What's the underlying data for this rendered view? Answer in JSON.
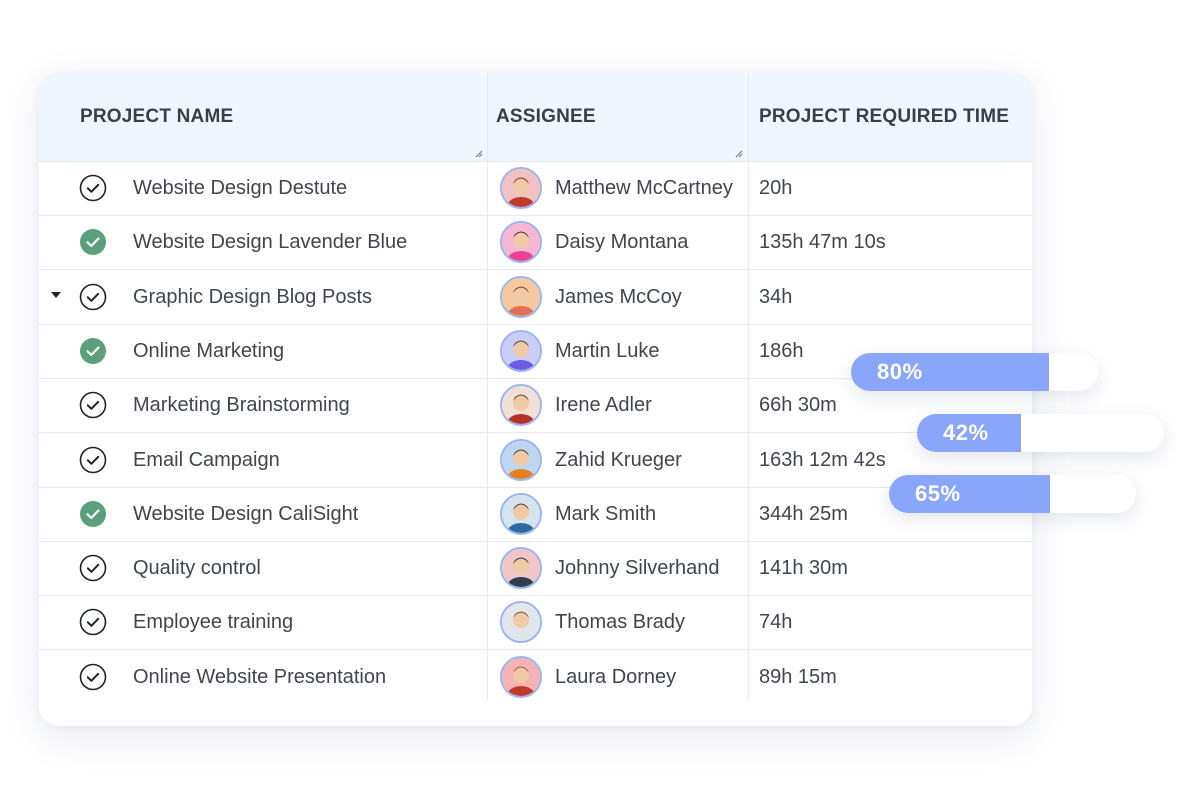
{
  "table": {
    "columns": [
      "PROJECT NAME",
      "ASSIGNEE",
      "PROJECT REQUIRED TIME"
    ],
    "rows": [
      {
        "project": "Website Design Destute",
        "status": "outline-check",
        "assignee": "Matthew McCartney",
        "time": "20h",
        "expanded": false
      },
      {
        "project": "Website Design Lavender Blue",
        "status": "filled-check",
        "assignee": "Daisy Montana",
        "time": "135h 47m 10s",
        "expanded": false
      },
      {
        "project": "Graphic Design Blog Posts",
        "status": "outline-check",
        "assignee": "James McCoy",
        "time": "34h",
        "expanded": true
      },
      {
        "project": "Online Marketing",
        "status": "filled-check",
        "assignee": "Martin Luke",
        "time": "186h",
        "expanded": false
      },
      {
        "project": "Marketing Brainstorming",
        "status": "outline-check",
        "assignee": "Irene Adler",
        "time": "66h 30m",
        "expanded": false
      },
      {
        "project": "Email Campaign",
        "status": "outline-check",
        "assignee": "Zahid Krueger",
        "time": "163h 12m 42s",
        "expanded": false
      },
      {
        "project": "Website Design CaliSight",
        "status": "filled-check",
        "assignee": "Mark Smith",
        "time": "344h 25m",
        "expanded": false
      },
      {
        "project": "Quality control",
        "status": "outline-check",
        "assignee": "Johnny Silverhand",
        "time": "141h 30m",
        "expanded": false
      },
      {
        "project": "Employee training",
        "status": "outline-check",
        "assignee": "Thomas Brady",
        "time": "74h",
        "expanded": false
      },
      {
        "project": "Online Website Presentation",
        "status": "outline-check",
        "assignee": "Laura Dorney",
        "time": "89h 15m",
        "expanded": false
      }
    ]
  },
  "progress_bars": [
    {
      "label": "80%",
      "value": 0.8
    },
    {
      "label": "42%",
      "value": 0.42
    },
    {
      "label": "65%",
      "value": 0.65
    }
  ],
  "colors": {
    "header_bg": "#eff6fe",
    "check_done": "#5aa07c",
    "progress_fill": "#8aa6fb",
    "avatar_border": "#9db4f2"
  },
  "icons": {
    "status_outline": "check-circle-outline-icon",
    "status_filled": "check-circle-filled-icon",
    "expand": "caret-down-icon",
    "resize": "column-resize-handle-icon"
  }
}
